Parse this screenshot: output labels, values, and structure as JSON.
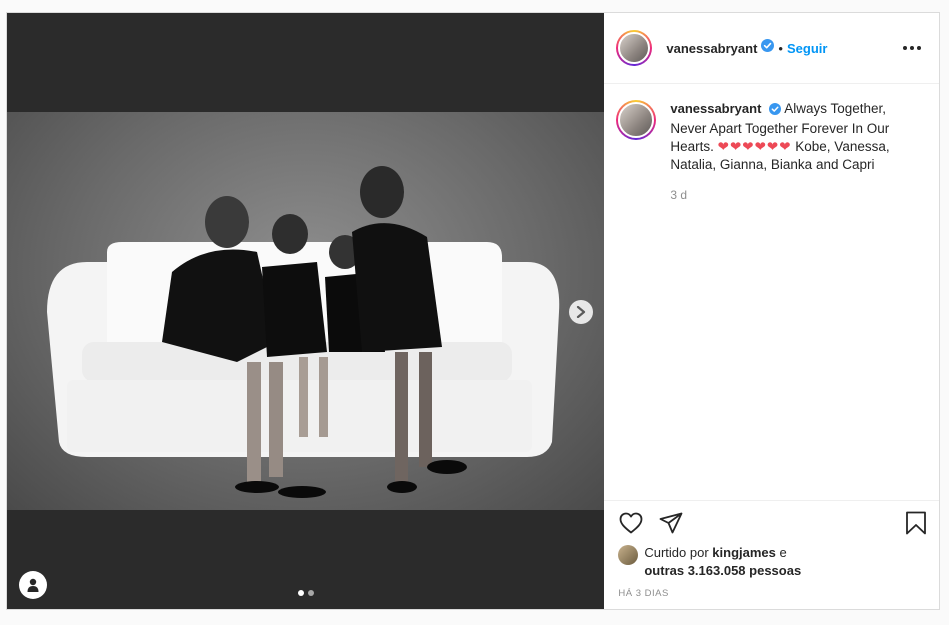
{
  "post": {
    "author": "vanessabryant",
    "follow_label": "Seguir",
    "separator": "•",
    "caption": "Always Together, Never Apart Together Forever In Our Hearts.",
    "caption_hearts": "❤❤❤❤❤❤",
    "caption_tail": "Kobe, Vanessa, Natalia, Gianna, Bianka and Capri",
    "caption_time": "3 d",
    "likes_prefix": "Curtido por",
    "likes_user": "kingjames",
    "likes_mid": "e",
    "likes_others": "outras 3.163.058 pessoas",
    "posted_ago": "HÁ 3 DIAS"
  },
  "carousel": {
    "current": 1,
    "total": 2
  },
  "icons": {
    "verified": "verified-badge-icon",
    "more": "more-options-icon",
    "like": "heart-outline-icon",
    "share": "paper-plane-icon",
    "save": "bookmark-icon",
    "next": "chevron-right-icon",
    "tags": "user-tag-icon"
  },
  "colors": {
    "accent": "#0095f6",
    "verified": "#3897f0",
    "heart": "#ed4956"
  }
}
